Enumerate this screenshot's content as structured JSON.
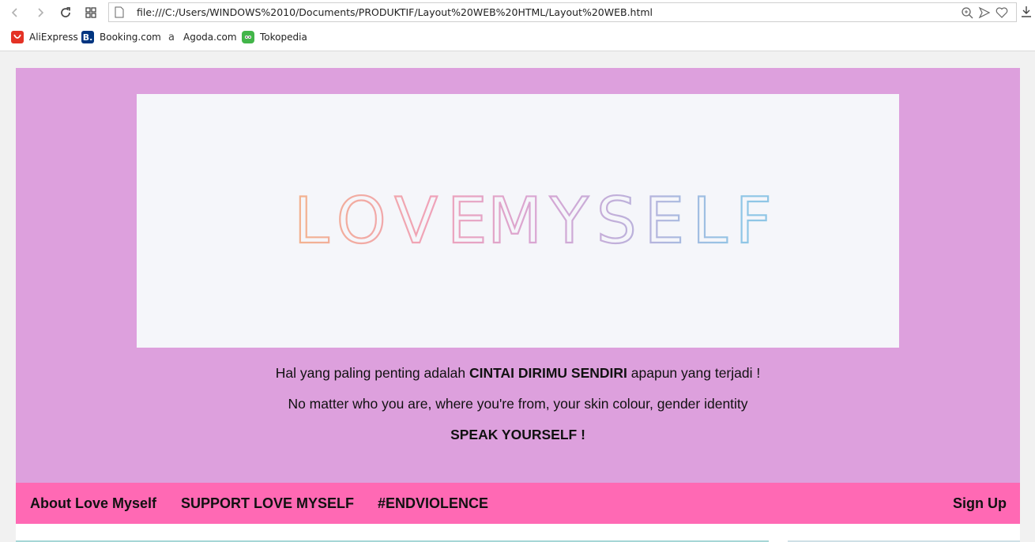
{
  "browser": {
    "url": "file:///C:/Users/WINDOWS%2010/Documents/PRODUKTIF/Layout%20WEB%20HTML/Layout%20WEB.html",
    "bookmarks": [
      {
        "label": "AliExpress",
        "icon": "aliexpress-icon",
        "color": "#e43225"
      },
      {
        "label": "Booking.com",
        "icon": "booking-icon",
        "color": "#003580"
      },
      {
        "label": "Agoda.com",
        "icon": "agoda-icon",
        "color": "#ffffff"
      },
      {
        "label": "Tokopedia",
        "icon": "tokopedia-icon",
        "color": "#42b549"
      }
    ]
  },
  "banner": {
    "word1": "LOVE",
    "word2": "MYSELF"
  },
  "tagline": {
    "line1_pre": "Hal yang paling penting adalah ",
    "line1_bold": "CINTAI DIRIMU SENDIRI",
    "line1_post": " apapun yang terjadi !",
    "line2": "No matter who you are, where you're from, your skin colour, gender identity",
    "line3": "SPEAK YOURSELF !"
  },
  "nav": {
    "about": "About Love Myself",
    "support": "SUPPORT LOVE MYSELF",
    "endviolence": "#ENDVIOLENCE",
    "signup": "Sign Up"
  },
  "colors": {
    "header_bg": "#dda0dd",
    "nav_bg": "#ff69b4",
    "banner_bg": "#f5f6fa"
  }
}
